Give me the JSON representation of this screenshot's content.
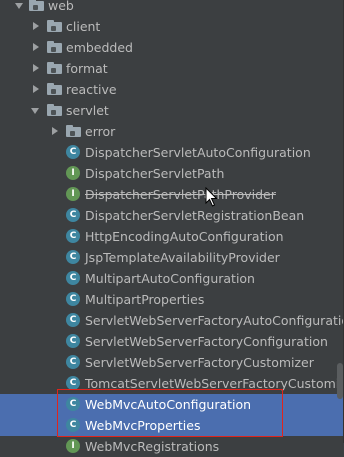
{
  "tree": {
    "items": [
      {
        "label": "web",
        "kind": "folder",
        "expanded": true
      },
      {
        "label": "client",
        "kind": "folder",
        "expanded": false
      },
      {
        "label": "embedded",
        "kind": "folder",
        "expanded": false
      },
      {
        "label": "format",
        "kind": "folder",
        "expanded": false
      },
      {
        "label": "reactive",
        "kind": "folder",
        "expanded": false
      },
      {
        "label": "servlet",
        "kind": "folder",
        "expanded": true
      },
      {
        "label": "error",
        "kind": "folder",
        "expanded": false
      },
      {
        "label": "DispatcherServletAutoConfiguration",
        "kind": "class",
        "icon_letter": "C"
      },
      {
        "label": "DispatcherServletPath",
        "kind": "interface",
        "icon_letter": "I"
      },
      {
        "label": "DispatcherServletPathProvider",
        "kind": "interface",
        "icon_letter": "I",
        "deprecated": true
      },
      {
        "label": "DispatcherServletRegistrationBean",
        "kind": "class",
        "icon_letter": "C"
      },
      {
        "label": "HttpEncodingAutoConfiguration",
        "kind": "class",
        "icon_letter": "C"
      },
      {
        "label": "JspTemplateAvailabilityProvider",
        "kind": "class",
        "icon_letter": "C"
      },
      {
        "label": "MultipartAutoConfiguration",
        "kind": "class",
        "icon_letter": "C"
      },
      {
        "label": "MultipartProperties",
        "kind": "class",
        "icon_letter": "C"
      },
      {
        "label": "ServletWebServerFactoryAutoConfiguration",
        "kind": "class",
        "icon_letter": "C"
      },
      {
        "label": "ServletWebServerFactoryConfiguration",
        "kind": "class",
        "icon_letter": "C"
      },
      {
        "label": "ServletWebServerFactoryCustomizer",
        "kind": "class",
        "icon_letter": "C"
      },
      {
        "label": "TomcatServletWebServerFactoryCustomizer",
        "kind": "class",
        "icon_letter": "C"
      },
      {
        "label": "WebMvcAutoConfiguration",
        "kind": "class",
        "icon_letter": "C",
        "selected": true
      },
      {
        "label": "WebMvcProperties",
        "kind": "class",
        "icon_letter": "C",
        "selected": true
      },
      {
        "label": "WebMvcRegistrations",
        "kind": "interface",
        "icon_letter": "I"
      }
    ]
  },
  "colors": {
    "background": "#3c3f41",
    "selection": "#4b6eaf",
    "class_icon": "#3e86a0",
    "interface_icon": "#629755",
    "highlight_box": "#e0241c",
    "folder_icon": "#9aa7b0"
  },
  "icons": {
    "folder": "package-folder-icon",
    "class": "class-icon",
    "interface": "interface-icon",
    "expand": "chevron-right-icon",
    "collapse": "chevron-down-icon"
  }
}
